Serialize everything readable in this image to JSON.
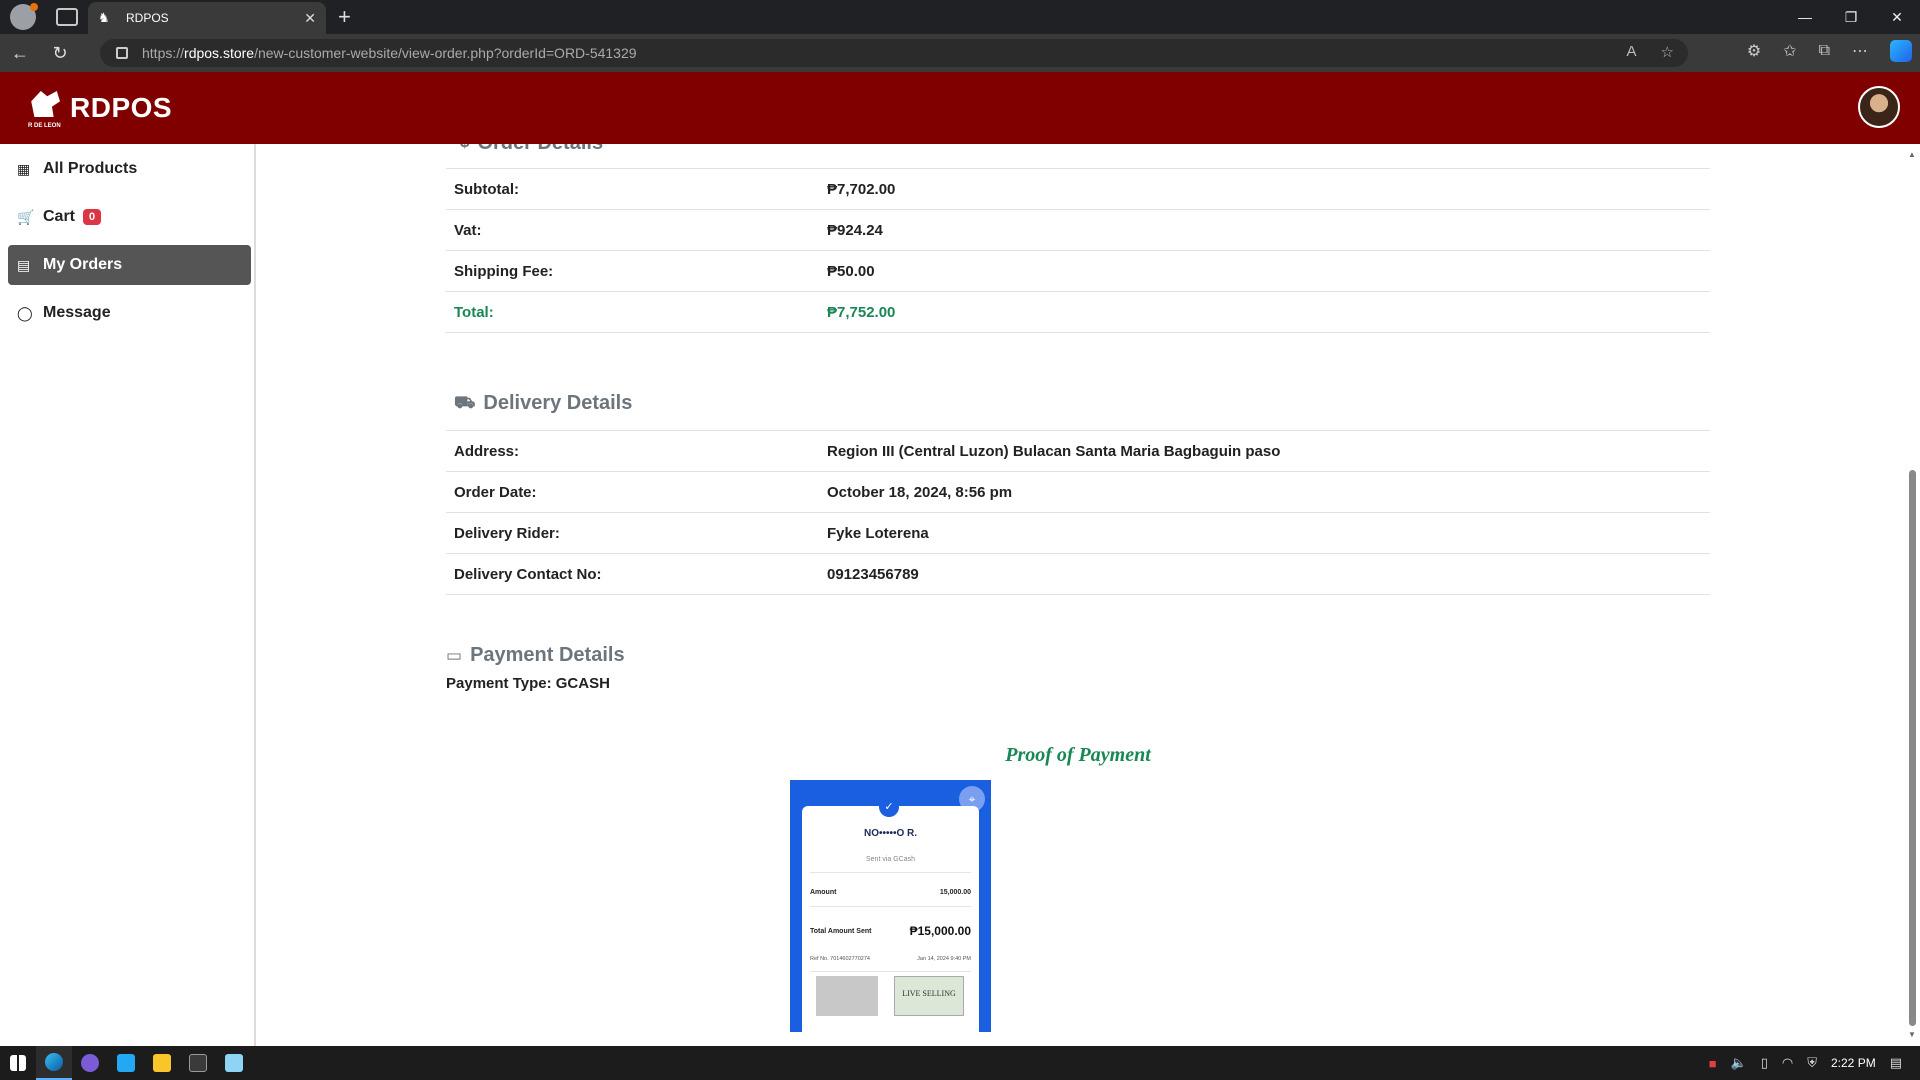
{
  "browser": {
    "tab_title": "RDPOS",
    "url_prefix": "https://",
    "url_host": "rdpos.store",
    "url_path": "/new-customer-website/view-order.php?orderId=ORD-541329"
  },
  "header": {
    "logo_text": "RDPOS",
    "logo_sub": "R DE LEON"
  },
  "sidebar": {
    "items": [
      {
        "label": "All Products",
        "icon": "store-icon"
      },
      {
        "label": "Cart",
        "icon": "cart-icon",
        "badge": "0"
      },
      {
        "label": "My Orders",
        "icon": "orders-icon",
        "active": true
      },
      {
        "label": "Message",
        "icon": "chat-icon"
      }
    ]
  },
  "order": {
    "title": "Order Details",
    "rows": [
      {
        "label": "Subtotal:",
        "value": "₱7,702.00"
      },
      {
        "label": "Vat:",
        "value": "₱924.24"
      },
      {
        "label": "Shipping Fee:",
        "value": "₱50.00"
      },
      {
        "label": "Total:",
        "value": "₱7,752.00"
      }
    ]
  },
  "delivery": {
    "title": "Delivery Details",
    "rows": [
      {
        "label": "Address:",
        "value": "Region III (Central Luzon) Bulacan Santa Maria Bagbaguin paso"
      },
      {
        "label": "Order Date:",
        "value": "October 18, 2024, 8:56 pm"
      },
      {
        "label": "Delivery Rider:",
        "value": "Fyke Loterena"
      },
      {
        "label": "Delivery Contact No:",
        "value": "09123456789"
      }
    ]
  },
  "payment": {
    "title": "Payment Details",
    "type_text": "Payment Type: GCASH",
    "proof_title": "Proof of Payment",
    "receipt": {
      "name": "NO•••••O R.",
      "sent_via": "Sent via GCash",
      "amount_label": "Amount",
      "amount_value": "15,000.00",
      "total_label": "Total Amount Sent",
      "total_value": "₱15,000.00",
      "ref_text": "Ref No. 7014602770274",
      "ref_date": "Jan 14, 2024 9:40 PM",
      "thumb_text": "LIVE SELLING"
    }
  },
  "taskbar": {
    "time": "2:22 PM"
  },
  "colors": {
    "brand": "#800000",
    "total_green": "#198754",
    "badge_red": "#dc3545"
  }
}
